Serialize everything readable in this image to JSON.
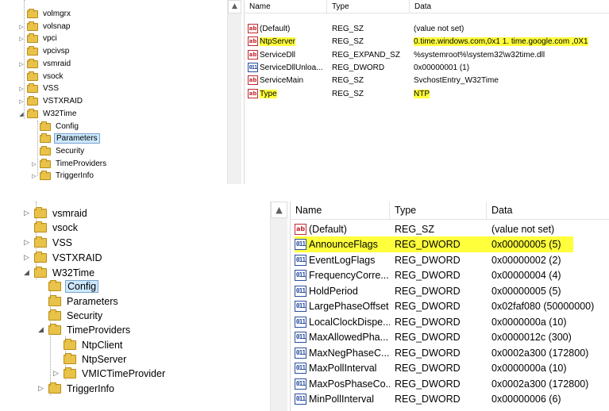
{
  "screenshot1": {
    "tree": {
      "items": [
        {
          "label": "volmgrx",
          "arrow": ""
        },
        {
          "label": "volsnap",
          "arrow": "▷"
        },
        {
          "label": "vpci",
          "arrow": "▷"
        },
        {
          "label": "vpcivsp",
          "arrow": ""
        },
        {
          "label": "vsmraid",
          "arrow": "▷"
        },
        {
          "label": "vsock",
          "arrow": ""
        },
        {
          "label": "VSS",
          "arrow": "▷"
        },
        {
          "label": "VSTXRAID",
          "arrow": "▷"
        },
        {
          "label": "W32Time",
          "arrow": "◢"
        },
        {
          "label": "Config",
          "arrow": ""
        },
        {
          "label": "Parameters",
          "arrow": ""
        },
        {
          "label": "Security",
          "arrow": ""
        },
        {
          "label": "TimeProviders",
          "arrow": "▷"
        },
        {
          "label": "TriggerInfo",
          "arrow": "▷"
        }
      ],
      "selected": "Parameters",
      "scroll_up_glyph": "▲"
    },
    "list": {
      "columns": [
        "Name",
        "Type",
        "Data"
      ],
      "rows": [
        {
          "name": "(Default)",
          "type": "REG_SZ",
          "data": "(value not set)",
          "icon": "ab"
        },
        {
          "name": "NtpServer",
          "type": "REG_SZ",
          "data": "0.time.windows.com,0x1 1. time.google.com ,0X1",
          "icon": "ab"
        },
        {
          "name": "ServiceDll",
          "type": "REG_EXPAND_SZ",
          "data": "%systemroot%\\system32\\w32time.dll",
          "icon": "ab"
        },
        {
          "name": "ServiceDllUnloa...",
          "type": "REG_DWORD",
          "data": "0x00000001 (1)",
          "icon": "011"
        },
        {
          "name": "ServiceMain",
          "type": "REG_SZ",
          "data": "SvchostEntry_W32Time",
          "icon": "ab"
        },
        {
          "name": "Type",
          "type": "REG_SZ",
          "data": "NTP",
          "icon": "ab"
        }
      ],
      "highlight_color": "#ffff3c"
    }
  },
  "screenshot2": {
    "tree": {
      "items": [
        {
          "label": "vsmraid",
          "arrow": "▷"
        },
        {
          "label": "vsock",
          "arrow": ""
        },
        {
          "label": "VSS",
          "arrow": "▷"
        },
        {
          "label": "VSTXRAID",
          "arrow": "▷"
        },
        {
          "label": "W32Time",
          "arrow": "◢"
        },
        {
          "label": "Config",
          "arrow": ""
        },
        {
          "label": "Parameters",
          "arrow": ""
        },
        {
          "label": "Security",
          "arrow": ""
        },
        {
          "label": "TimeProviders",
          "arrow": "◢"
        },
        {
          "label": "NtpClient",
          "arrow": ""
        },
        {
          "label": "NtpServer",
          "arrow": ""
        },
        {
          "label": "VMICTimeProvider",
          "arrow": "▷"
        },
        {
          "label": "TriggerInfo",
          "arrow": "▷"
        }
      ],
      "selected": "Config",
      "scroll_up_glyph": "▲"
    },
    "list": {
      "columns": [
        "Name",
        "Type",
        "Data"
      ],
      "rows": [
        {
          "name": "(Default)",
          "type": "REG_SZ",
          "data": "(value not set)",
          "icon": "ab"
        },
        {
          "name": "AnnounceFlags",
          "type": "REG_DWORD",
          "data": "0x00000005 (5)",
          "icon": "011"
        },
        {
          "name": "EventLogFlags",
          "type": "REG_DWORD",
          "data": "0x00000002 (2)",
          "icon": "011"
        },
        {
          "name": "FrequencyCorre...",
          "type": "REG_DWORD",
          "data": "0x00000004 (4)",
          "icon": "011"
        },
        {
          "name": "HoldPeriod",
          "type": "REG_DWORD",
          "data": "0x00000005 (5)",
          "icon": "011"
        },
        {
          "name": "LargePhaseOffset",
          "type": "REG_DWORD",
          "data": "0x02faf080 (50000000)",
          "icon": "011"
        },
        {
          "name": "LocalClockDispe...",
          "type": "REG_DWORD",
          "data": "0x0000000a (10)",
          "icon": "011"
        },
        {
          "name": "MaxAllowedPha...",
          "type": "REG_DWORD",
          "data": "0x0000012c (300)",
          "icon": "011"
        },
        {
          "name": "MaxNegPhaseC...",
          "type": "REG_DWORD",
          "data": "0x0002a300 (172800)",
          "icon": "011"
        },
        {
          "name": "MaxPollInterval",
          "type": "REG_DWORD",
          "data": "0x0000000a (10)",
          "icon": "011"
        },
        {
          "name": "MaxPosPhaseCo...",
          "type": "REG_DWORD",
          "data": "0x0002a300 (172800)",
          "icon": "011"
        },
        {
          "name": "MinPollInterval",
          "type": "REG_DWORD",
          "data": "0x00000006 (6)",
          "icon": "011"
        }
      ],
      "highlight_color": "#ffff3c"
    }
  }
}
